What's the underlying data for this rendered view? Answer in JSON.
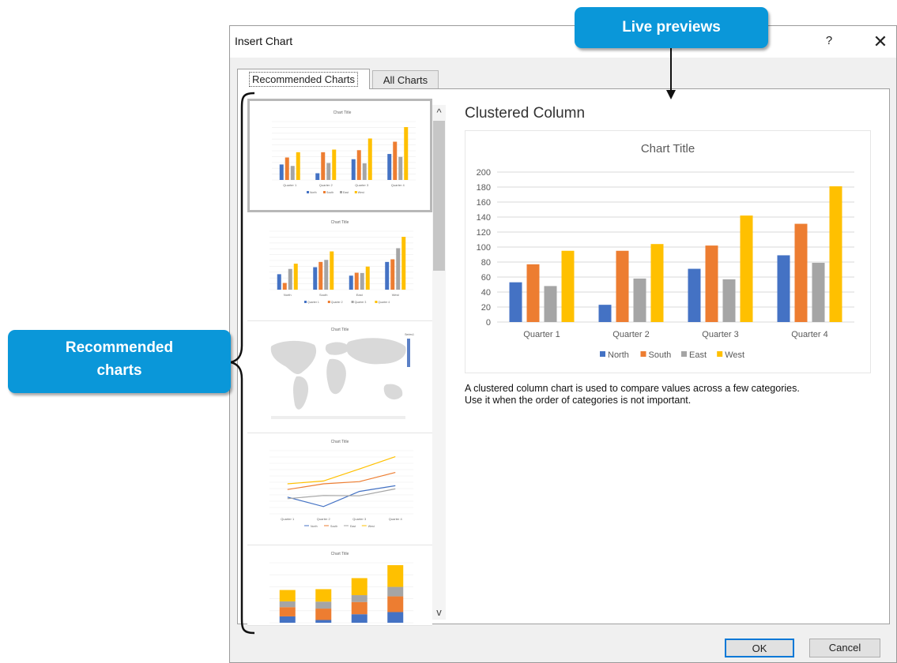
{
  "dialog": {
    "title": "Insert Chart",
    "help_label": "?",
    "close_label": "✕"
  },
  "tabs": [
    {
      "label": "Recommended Charts",
      "selected": true
    },
    {
      "label": "All Charts",
      "selected": false
    }
  ],
  "thumbnails": [
    {
      "type": "clustered-column",
      "title": "Chart Title",
      "categories": [
        "Quarter 1",
        "Quarter 2",
        "Quarter 3",
        "Quarter 4"
      ],
      "legend": [
        "North",
        "South",
        "East",
        "West"
      ],
      "selected": true
    },
    {
      "type": "clustered-column",
      "title": "Chart Title",
      "categories": [
        "North",
        "South",
        "East",
        "West"
      ],
      "legend": [
        "Quarter 1",
        "Quarter 2",
        "Quarter 3",
        "Quarter 4"
      ],
      "selected": false
    },
    {
      "type": "map",
      "title": "Chart Title",
      "legend": [
        "Series1"
      ],
      "selected": false
    },
    {
      "type": "line",
      "title": "Chart Title",
      "categories": [
        "Quarter 1",
        "Quarter 2",
        "Quarter 3",
        "Quarter 4"
      ],
      "legend": [
        "North",
        "South",
        "East",
        "West"
      ],
      "selected": false
    },
    {
      "type": "stacked-column",
      "title": "Chart Title",
      "selected": false
    }
  ],
  "scrollbar": {
    "up_icon": "^",
    "down_icon": "v"
  },
  "preview": {
    "name": "Clustered Column",
    "description_line1": "A clustered column chart is used to compare values across a few categories.",
    "description_line2": "Use it when the order of categories is not important."
  },
  "colors": {
    "north": "#4472c4",
    "south": "#ed7d31",
    "east": "#a5a5a5",
    "west": "#ffc000",
    "callout": "#0a97d9",
    "accent": "#0078d7"
  },
  "chart_data": {
    "type": "bar",
    "title": "Chart Title",
    "categories": [
      "Quarter 1",
      "Quarter 2",
      "Quarter 3",
      "Quarter 4"
    ],
    "series": [
      {
        "name": "North",
        "values": [
          53,
          23,
          71,
          89
        ]
      },
      {
        "name": "South",
        "values": [
          77,
          95,
          102,
          131
        ]
      },
      {
        "name": "East",
        "values": [
          48,
          58,
          57,
          79
        ]
      },
      {
        "name": "West",
        "values": [
          95,
          104,
          142,
          181
        ]
      }
    ],
    "yticks": [
      0,
      20,
      40,
      60,
      80,
      100,
      120,
      140,
      160,
      180,
      200
    ],
    "ylim": [
      0,
      200
    ],
    "grid": true,
    "legend_position": "bottom"
  },
  "buttons": {
    "ok": "OK",
    "cancel": "Cancel"
  },
  "callouts": {
    "live_previews": "Live previews",
    "recommended_line1": "Recommended",
    "recommended_line2": "charts"
  }
}
